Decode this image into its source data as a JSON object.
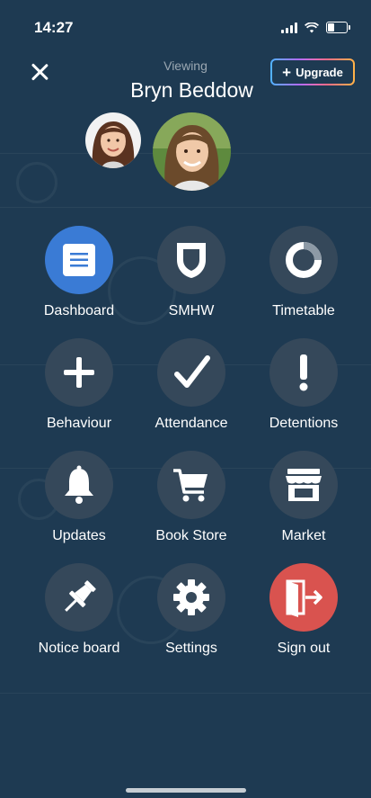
{
  "status_bar": {
    "time": "14:27"
  },
  "header": {
    "viewing_label": "Viewing",
    "student_name": "Bryn Beddow",
    "upgrade_label": "Upgrade"
  },
  "menu": [
    {
      "label": "Dashboard",
      "icon": "document-icon",
      "active": true
    },
    {
      "label": "SMHW",
      "icon": "shield-icon"
    },
    {
      "label": "Timetable",
      "icon": "ring-icon"
    },
    {
      "label": "Behaviour",
      "icon": "plus-icon"
    },
    {
      "label": "Attendance",
      "icon": "checkmark-icon"
    },
    {
      "label": "Detentions",
      "icon": "exclamation-icon"
    },
    {
      "label": "Updates",
      "icon": "bell-icon"
    },
    {
      "label": "Book Store",
      "icon": "cart-icon"
    },
    {
      "label": "Market",
      "icon": "store-icon"
    },
    {
      "label": "Notice board",
      "icon": "pin-icon"
    },
    {
      "label": "Settings",
      "icon": "gear-icon"
    },
    {
      "label": "Sign out",
      "icon": "sign-out-icon",
      "accent": true
    }
  ],
  "colors": {
    "background": "#1e3a52",
    "icon_circle": "#35485a",
    "active": "#3a7bd5",
    "sign_out": "#d9534f"
  }
}
